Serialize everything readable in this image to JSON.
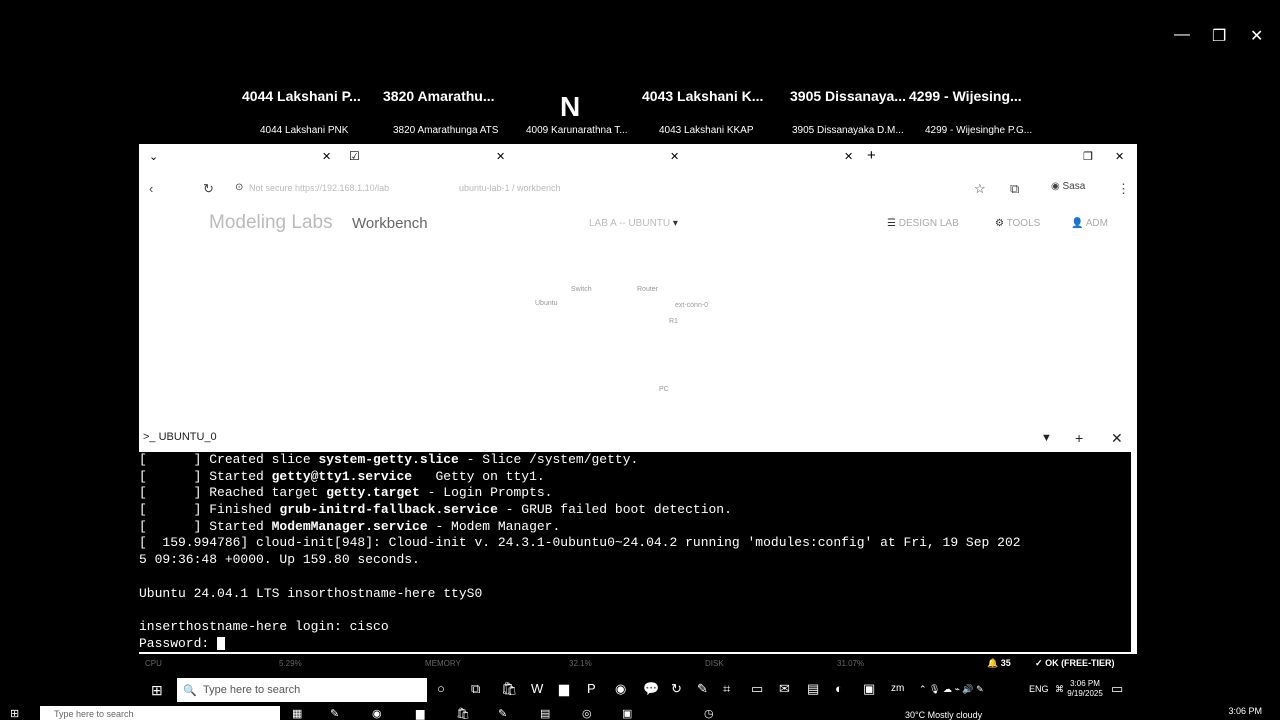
{
  "meeting": {
    "participants": [
      {
        "name": "4044 Lakshani P...",
        "label": "4044 Lakshani PNK"
      },
      {
        "name": "3820  Amarathu...",
        "label": "3820 Amarathunga ATS"
      },
      {
        "name": "",
        "label": "4009 Karunarathna T..."
      },
      {
        "name": "4043 Lakshani K...",
        "label": "4043 Lakshani KKAP"
      },
      {
        "name": "3905  Dissanaya...",
        "label": "3905 Dissanayaka D.M..."
      },
      {
        "name": "4299  -  Wijesing...",
        "label": "4299 - Wijesinghe P.G..."
      }
    ],
    "center_initial": "N"
  },
  "browser": {
    "tabs": [
      "",
      "",
      "",
      "",
      ""
    ],
    "url_left": "Not secure   https://192.168.1.10/lab",
    "url_right": "ubuntu-lab-1  /  workbench",
    "profile": "Sasa"
  },
  "app": {
    "brand": "Modeling Labs",
    "section": "Workbench",
    "lab_selector": "LAB  A  --  UBUNTU",
    "hdr_tools": "DESIGN LAB",
    "hdr_settings": "TOOLS",
    "hdr_user": "ADM"
  },
  "canvas": {
    "nodes": [
      "Ubuntu",
      "Switch",
      "Router",
      "ext-conn-0",
      "R1",
      "PC"
    ]
  },
  "console": {
    "title": "UBUNTU_0",
    "lines": [
      {
        "pre": "[      ] Created slice ",
        "bold": "system-getty.slice",
        "post": " - Slice /system/getty."
      },
      {
        "pre": "[      ] Started ",
        "bold": "getty@tty1.service",
        "post": "   Getty on tty1."
      },
      {
        "pre": "[      ] Reached target ",
        "bold": "getty.target",
        "post": " - Login Prompts."
      },
      {
        "pre": "[      ] Finished ",
        "bold": "grub-initrd-fallback.service",
        "post": " - GRUB failed boot detection."
      },
      {
        "pre": "[      ] Started ",
        "bold": "ModemManager.service",
        "post": " - Modem Manager."
      },
      {
        "pre": "[  159.994786] cloud-init[948]: Cloud-init v. 24.3.1-0ubuntu0~24.04.2 running 'modules:config' at Fri, 19 Sep 202",
        "bold": "",
        "post": ""
      },
      {
        "pre": "5 09:36:48 +0000. Up 159.80 seconds.",
        "bold": "",
        "post": ""
      },
      {
        "pre": "",
        "bold": "",
        "post": ""
      },
      {
        "pre": "Ubuntu 24.04.1 LTS insorthostname-here ttyS0",
        "bold": "",
        "post": ""
      },
      {
        "pre": "",
        "bold": "",
        "post": ""
      },
      {
        "pre": "inserthostname-here login: cisco",
        "bold": "",
        "post": ""
      },
      {
        "pre": "Password: ",
        "bold": "",
        "post": ""
      }
    ]
  },
  "statusbar": {
    "cpu": "CPU",
    "cpu_val": "5.29%",
    "mem": "MEMORY",
    "mem_val": "32.1%",
    "disk": "DISK",
    "disk_val": "31.07%",
    "notifications": "35",
    "license": "OK (FREE-TIER)"
  },
  "taskbar": {
    "search_placeholder": "Type here to search",
    "lang": "ENG",
    "time": "3:06 PM",
    "date": "9/19/2025"
  },
  "bottom": {
    "search_placeholder": "Type here to search",
    "weather": "30°C  Mostly cloudy",
    "time": "3:06 PM"
  }
}
